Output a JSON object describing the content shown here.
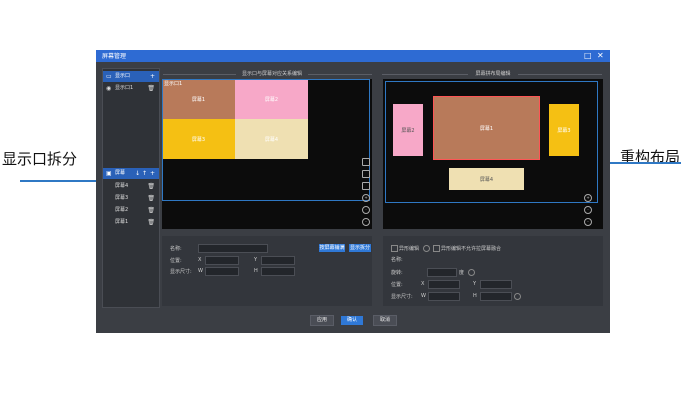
{
  "annotations": {
    "left_label": "显示口拆分",
    "right_label": "重构布局"
  },
  "window": {
    "title": "屏幕管理",
    "restore_icon": "□",
    "close_icon": "✕"
  },
  "sidebar": {
    "display_port_header": "显示口",
    "display_port_1": "显示口1",
    "screen_header": "屏幕",
    "screens": [
      "屏幕4",
      "屏幕3",
      "屏幕2",
      "屏幕1"
    ],
    "add_icon": "+",
    "delete_icon": "🗑",
    "up_icon": "↑",
    "down_icon": "↓"
  },
  "left_panel": {
    "title": "显示口与屏幕对应关系编辑",
    "port_label": "显示口1",
    "tiles": [
      "屏幕1",
      "屏幕2",
      "屏幕3",
      "屏幕4"
    ]
  },
  "right_panel": {
    "title": "屏幕拼布局编辑",
    "tiles": [
      "屏幕2",
      "屏幕1",
      "屏幕3",
      "屏幕4"
    ]
  },
  "left_form": {
    "name_label": "名称:",
    "position_label": "位置:",
    "size_label": "显示尺寸:",
    "x_label": "X",
    "y_label": "Y",
    "w_label": "W",
    "h_label": "H",
    "btn_auto": "按屏幕铺满",
    "btn_split": "显示拆分"
  },
  "right_form": {
    "checkbox1": "异形编辑",
    "checkbox2": "异形编辑不允许拉屏幕融合",
    "name_label": "名称:",
    "rotate_label": "旋转:",
    "degree": "度",
    "position_label": "位置:",
    "size_label": "显示尺寸:",
    "x_label": "X",
    "y_label": "Y",
    "w_label": "W",
    "h_label": "H"
  },
  "footer": {
    "apply": "应用",
    "ok": "确认",
    "cancel": "取消"
  },
  "colors": {
    "accent": "#2e6bd3",
    "tile_brown": "#b87a5a",
    "tile_pink": "#f7a8c8",
    "tile_yellow": "#f5c013",
    "tile_cream": "#efe0b2"
  }
}
